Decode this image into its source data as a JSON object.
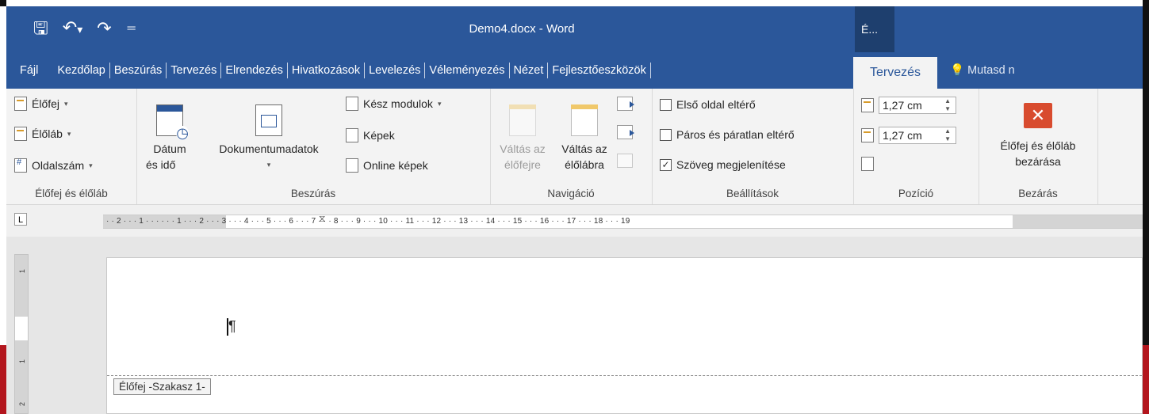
{
  "window": {
    "title": "Demo4.docx  -  Word",
    "context_title": "É..."
  },
  "qat": {
    "save_icon": "save-icon",
    "undo_icon": "undo-icon",
    "redo_icon": "redo-icon",
    "customize_icon": "customize-qat-icon"
  },
  "tabs": [
    {
      "label": "Fájl"
    },
    {
      "label": "Kezdőlap"
    },
    {
      "label": "Beszúrás"
    },
    {
      "label": "Tervezés"
    },
    {
      "label": "Elrendezés"
    },
    {
      "label": "Hivatkozások"
    },
    {
      "label": "Levelezés"
    },
    {
      "label": "Véleményezés"
    },
    {
      "label": "Nézet"
    },
    {
      "label": "Fejlesztőeszközök"
    }
  ],
  "active_tab": "Tervezés",
  "tell_me": "Mutasd n",
  "ribbon": {
    "hf": {
      "header": "Élőfej",
      "footer": "Élőláb",
      "page_number": "Oldalszám",
      "label": "Élőfej és élőláb"
    },
    "insert": {
      "date_l1": "Dátum",
      "date_l2": "és idő",
      "docinfo": "Dokumentumadatok",
      "quick_parts": "Kész modulok",
      "pictures": "Képek",
      "online_pictures": "Online képek",
      "label": "Beszúrás"
    },
    "nav": {
      "goto_header_l1": "Váltás az",
      "goto_header_l2": "élőfejre",
      "goto_footer_l1": "Váltás az",
      "goto_footer_l2": "élőlábra",
      "label": "Navigáció"
    },
    "options": {
      "different_first": "Első oldal eltérő",
      "different_odd_even": "Páros és páratlan eltérő",
      "show_text": "Szöveg megjelenítése",
      "different_first_checked": false,
      "different_odd_even_checked": false,
      "show_text_checked": true,
      "label": "Beállítások"
    },
    "position": {
      "header_from_top": "1,27 cm",
      "footer_from_bottom": "1,27 cm",
      "label": "Pozíció"
    },
    "close": {
      "l1": "Élőfej és élőláb",
      "l2": "bezárása",
      "label": "Bezárás"
    }
  },
  "ruler": {
    "tab_selector": "L",
    "ticks": "· · 2 · · · 1 · · ·     · · · 1 · · · 2 · · · 3 · · · 4 · · · 5 · · · 6 · · · 7 · · · 8 · · · 9 · · · 10 · · · 11 · · · 12 · · · 13 · · · 14 · · · 15 · · · 16 · · · 17 · · · 18 · · · 19"
  },
  "vruler": {
    "n1": "1",
    "n2": "1",
    "n3": "2"
  },
  "document": {
    "pilcrow": "¶",
    "header_tag": "Élőfej -Szakasz 1-"
  }
}
